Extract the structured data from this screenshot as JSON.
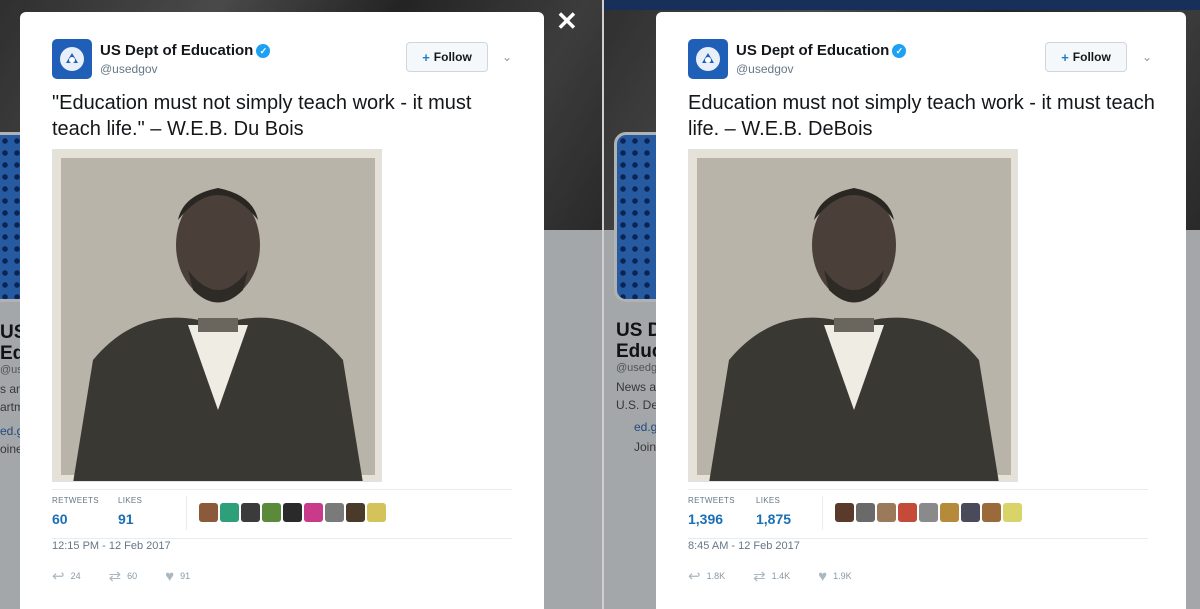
{
  "screenshots": [
    {
      "side": "left",
      "close_glyph": "✕",
      "background_profile": {
        "name_line1": "US De",
        "name_line2": "Educa",
        "handle": "@usedg",
        "bio_line1": "s and",
        "bio_line2": "artme",
        "link": "ed.go",
        "joined": "oined"
      },
      "tweet": {
        "account_name": "US Dept of Education",
        "verified_glyph": "✓",
        "handle": "@usedgov",
        "follow_label": "Follow",
        "follow_icon": "person-plus-icon",
        "text": "\"Education must not simply teach work - it must teach life.\" – W.E.B. Du Bois",
        "stats": {
          "retweets_label": "RETWEETS",
          "retweets_value": "60",
          "likes_label": "LIKES",
          "likes_value": "91"
        },
        "liker_colors": [
          "#8a5a3a",
          "#2f9f7a",
          "#3b3b3b",
          "#5a8a3a",
          "#2a2a2a",
          "#c93a8a",
          "#7a7a7a",
          "#4a3a2a",
          "#d4c25a"
        ],
        "timestamp": "12:15 PM - 12 Feb 2017",
        "actions": {
          "replies": "24",
          "retweets": "60",
          "likes": "91"
        }
      }
    },
    {
      "side": "right",
      "background_profile": {
        "name_line1": "US D",
        "name_line2": "Educ",
        "handle": "@usedg",
        "bio_line1": "News a",
        "bio_line2": "U.S. De",
        "link": "ed.g",
        "joined": "Join"
      },
      "tweet": {
        "account_name": "US Dept of Education",
        "verified_glyph": "✓",
        "handle": "@usedgov",
        "follow_label": "Follow",
        "follow_icon": "person-plus-icon",
        "text": "Education must not simply teach work - it must teach life. – W.E.B. DeBois",
        "stats": {
          "retweets_label": "RETWEETS",
          "retweets_value": "1,396",
          "likes_label": "LIKES",
          "likes_value": "1,875"
        },
        "liker_colors": [
          "#5a3a2a",
          "#6a6a6a",
          "#9a7a5a",
          "#c44a3a",
          "#8a8a8a",
          "#b58a3a",
          "#4a4a5a",
          "#9a6a3a",
          "#d8d46a"
        ],
        "timestamp": "8:45 AM - 12 Feb 2017",
        "actions": {
          "replies": "1.8K",
          "retweets": "1.4K",
          "likes": "1.9K"
        }
      }
    }
  ],
  "colors": {
    "accent": "#1da1f2",
    "link": "#1b6fb5",
    "brand_avatar": "#1f5fb8"
  }
}
